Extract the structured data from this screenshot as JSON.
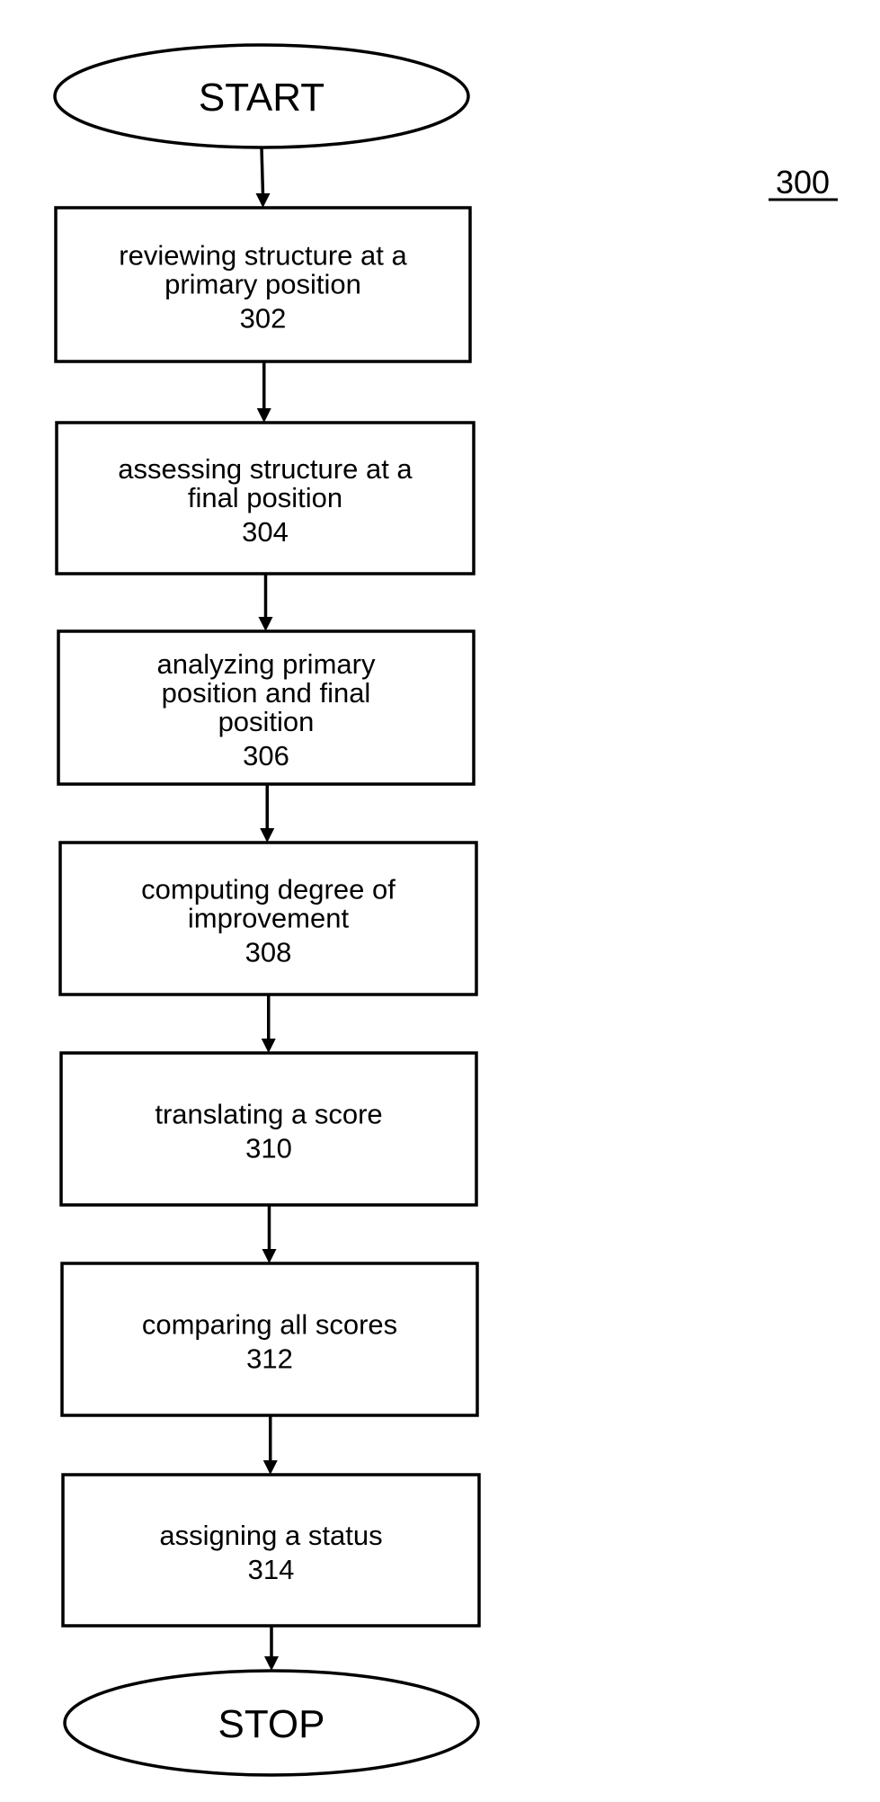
{
  "figure": {
    "reference_label": "300",
    "colors": {
      "stroke": "#000000",
      "fill": "#ffffff",
      "text": "#000000"
    }
  },
  "flowchart": {
    "start": {
      "label": "START",
      "shape": "ellipse"
    },
    "steps": [
      {
        "id": "302",
        "lines": [
          "reviewing structure at a",
          "primary position"
        ],
        "ref": "302"
      },
      {
        "id": "304",
        "lines": [
          "assessing structure at a",
          "final position"
        ],
        "ref": "304"
      },
      {
        "id": "306",
        "lines": [
          "analyzing primary",
          "position and final",
          "position"
        ],
        "ref": "306"
      },
      {
        "id": "308",
        "lines": [
          "computing degree of",
          "improvement"
        ],
        "ref": "308"
      },
      {
        "id": "310",
        "lines": [
          "translating a score"
        ],
        "ref": "310"
      },
      {
        "id": "312",
        "lines": [
          "comparing all scores"
        ],
        "ref": "312"
      },
      {
        "id": "314",
        "lines": [
          "assigning a status"
        ],
        "ref": "314"
      }
    ],
    "stop": {
      "label": "STOP",
      "shape": "ellipse"
    },
    "edges": [
      {
        "from": "START",
        "to": "302"
      },
      {
        "from": "302",
        "to": "304"
      },
      {
        "from": "304",
        "to": "306"
      },
      {
        "from": "306",
        "to": "308"
      },
      {
        "from": "308",
        "to": "310"
      },
      {
        "from": "310",
        "to": "312"
      },
      {
        "from": "312",
        "to": "314"
      },
      {
        "from": "314",
        "to": "STOP"
      }
    ]
  }
}
